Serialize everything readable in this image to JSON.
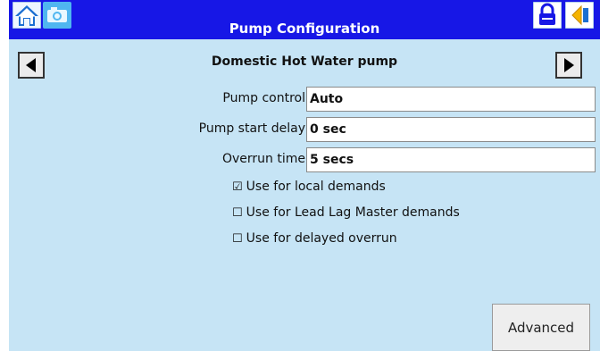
{
  "header": {
    "title": "Pump Configuration",
    "home_icon": "home-icon",
    "camera_icon": "camera-icon",
    "lock_icon": "lock-icon",
    "back_icon": "back-icon",
    "bar_color": "#1717e6"
  },
  "nav": {
    "subtitle": "Domestic Hot Water pump",
    "prev_icon": "left-arrow-icon",
    "next_icon": "right-arrow-icon"
  },
  "fields": [
    {
      "label": "Pump control",
      "value": "Auto"
    },
    {
      "label": "Pump start delay",
      "value": "0 sec"
    },
    {
      "label": "Overrun time",
      "value": "5 secs"
    }
  ],
  "checkboxes": [
    {
      "label": "Use for local demands",
      "checked": true,
      "box": "☑"
    },
    {
      "label": "Use for Lead Lag Master demands",
      "checked": false,
      "box": "☐"
    },
    {
      "label": "Use for delayed overrun",
      "checked": false,
      "box": "☐"
    }
  ],
  "actions": {
    "advanced_label": "Advanced"
  },
  "colors": {
    "background": "#c6e4f5",
    "accent": "#1717e6"
  }
}
